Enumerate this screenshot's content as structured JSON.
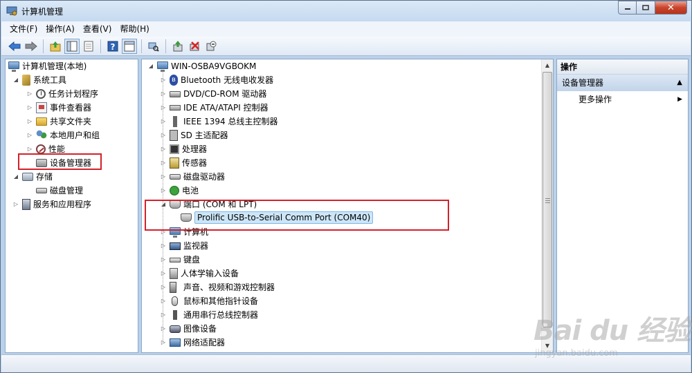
{
  "window": {
    "title": "计算机管理",
    "buttons": {
      "minimize": "‒",
      "maximize": "□",
      "close": "✕"
    }
  },
  "menu": [
    "文件(F)",
    "操作(A)",
    "查看(V)",
    "帮助(H)"
  ],
  "left_tree": {
    "root": "计算机管理(本地)",
    "system_tools": "系统工具",
    "task_scheduler": "任务计划程序",
    "event_viewer": "事件查看器",
    "shared_folders": "共享文件夹",
    "local_users": "本地用户和组",
    "performance": "性能",
    "device_manager": "设备管理器",
    "storage": "存储",
    "disk_management": "磁盘管理",
    "services_apps": "服务和应用程序"
  },
  "device_tree": {
    "computer_name": "WIN-OSBA9VGBOKM",
    "categories": [
      "Bluetooth 无线电收发器",
      "DVD/CD-ROM 驱动器",
      "IDE ATA/ATAPI 控制器",
      "IEEE 1394 总线主控制器",
      "SD 主适配器",
      "处理器",
      "传感器",
      "磁盘驱动器",
      "电池",
      "端口 (COM 和 LPT)",
      "计算机",
      "监视器",
      "键盘",
      "人体学输入设备",
      "声音、视频和游戏控制器",
      "鼠标和其他指针设备",
      "通用串行总线控制器",
      "图像设备",
      "网络适配器"
    ],
    "port_device": "Prolific USB-to-Serial Comm Port (COM40)"
  },
  "actions": {
    "header": "操作",
    "section": "设备管理器",
    "more": "更多操作"
  },
  "watermark": {
    "logo": "Bai du 经验",
    "sub": "jingyan.baidu.com"
  },
  "icons": {
    "back": "arrow-left-icon",
    "forward": "arrow-right-icon",
    "up": "folder-up-icon",
    "show_tree": "console-tree-icon",
    "properties": "properties-icon",
    "help": "help-icon",
    "view": "view-icon",
    "scan": "scan-hardware-icon",
    "update": "update-driver-icon",
    "uninstall": "uninstall-icon",
    "disable": "disable-icon"
  },
  "colors": {
    "highlight_border": "#d4202a",
    "selection_bg": "#cde6f7",
    "action_section_bg": "#c2d4ea"
  }
}
